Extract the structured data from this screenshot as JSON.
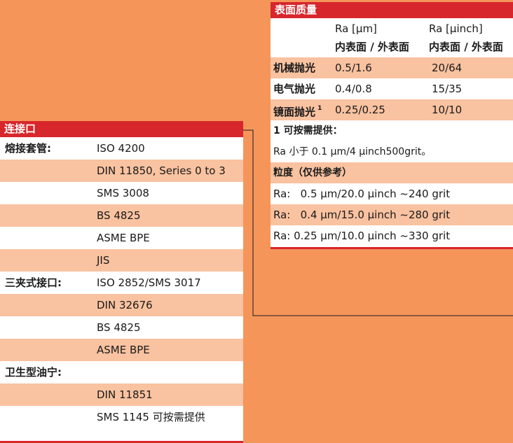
{
  "connections": {
    "title": "连接口",
    "rows": [
      {
        "label": "熔接套管:",
        "value": "ISO 4200"
      },
      {
        "label": "",
        "value": "DIN 11850, Series 0 to 3"
      },
      {
        "label": "",
        "value": "SMS 3008"
      },
      {
        "label": "",
        "value": "BS 4825"
      },
      {
        "label": "",
        "value": "ASME BPE"
      },
      {
        "label": "",
        "value": "JIS"
      },
      {
        "label": "三夹式接口:",
        "value": "ISO 2852/SMS 3017"
      },
      {
        "label": "",
        "value": "DIN 32676"
      },
      {
        "label": "",
        "value": "BS 4825"
      },
      {
        "label": "",
        "value": "ASME BPE"
      },
      {
        "label": "卫生型油宁:",
        "value": ""
      },
      {
        "label": "",
        "value": "DIN 11851"
      },
      {
        "label": "",
        "value": "SMS 1145 可按需提供"
      }
    ]
  },
  "surface": {
    "title": "表面质量",
    "col1_unit": "Ra [µm]",
    "col1_sub": "内表面 / 外表面",
    "col2_unit": "Ra [µinch]",
    "col2_sub": "内表面 / 外表面",
    "rows": [
      {
        "label": "机械抛光",
        "sup": "",
        "v1": "0.5/1.6",
        "v2": "20/64"
      },
      {
        "label": "电气抛光",
        "sup": "",
        "v1": "0.4/0.8",
        "v2": "15/35"
      },
      {
        "label": "镜面抛光",
        "sup": "1",
        "v1": "0.25/0.25",
        "v2": "10/10"
      }
    ],
    "footnote": "1 可按需提供：",
    "note": "Ra 小于 0.1 μm/4 μinch500grit。",
    "grit_title": "粒度（仅供参考）",
    "grit_rows": [
      "Ra:   0.5 µm/20.0 µinch ~240 grit",
      "Ra:   0.4 µm/15.0 µinch ~280 grit",
      "Ra: 0.25 µm/10.0 µinch ~330 grit"
    ]
  },
  "colors": {
    "background": "#F5955A",
    "header": "#D7262C",
    "alt_row": "#F9C2A0"
  }
}
